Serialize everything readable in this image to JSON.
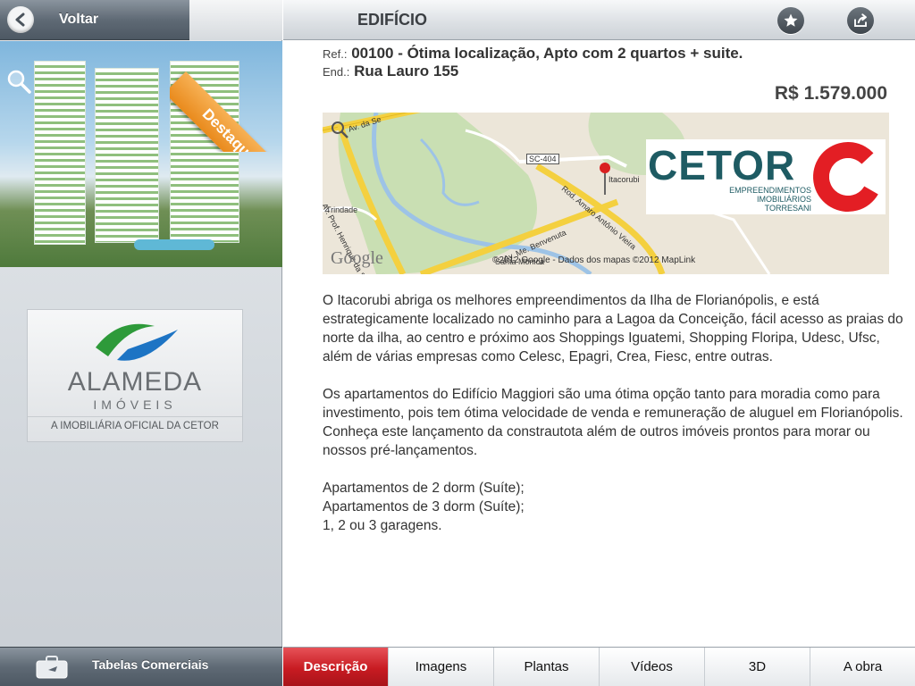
{
  "sidebar": {
    "back_label": "Voltar",
    "badge": "Destaque",
    "logo": {
      "name": "ALAMEDA",
      "sub": "IMÓVEIS",
      "tagline": "A IMOBILIÁRIA OFICIAL DA CETOR"
    },
    "bottom_label": "Tabelas Comerciais"
  },
  "header": {
    "title": "EDIFÍCIO",
    "favorite_icon": "star-icon",
    "share_icon": "share-icon"
  },
  "property": {
    "ref_label": "Ref.:",
    "ref_value": "00100 - Ótima localização, Apto com 2 quartos + suite.",
    "address_label": "End.:",
    "address_value": "Rua Lauro  155",
    "price": "R$ 1.579.000"
  },
  "map": {
    "labels": {
      "road_sc404": "SC-404",
      "itacorubi": "Itacorubi",
      "trindade": "Trindade",
      "av_se": "Av. da Se",
      "av_prof": "Av. Prof. Henrique da Silva Fontes",
      "rod_amaro": "Rod. Amaro Antônio Vieira",
      "av_benvenuta": "Av. Me. Benvenuta",
      "santa_monica": "Santa Mônica"
    },
    "google": "Google",
    "copyright": "©2012 Google - Dados dos mapas ©2012 MapLink",
    "cetor_name": "CETOR",
    "cetor_sub_1": "EMPREENDIMENTOS",
    "cetor_sub_2": "IMOBILIÁRIOS",
    "cetor_sub_3": "TORRESANI"
  },
  "description": {
    "p1": "O Itacorubi abriga os melhores empreendimentos da Ilha de Florianópolis, e está estrategicamente localizado no caminho para a Lagoa da Conceição, fácil acesso as praias do norte da ilha, ao centro e próximo aos Shoppings Iguatemi, Shopping Floripa, Udesc, Ufsc, além de várias empresas como Celesc, Epagri, Crea, Fiesc, entre outras.",
    "p2": "Os apartamentos do Edifício Maggiori são uma ótima opção tanto para moradia como para investimento, pois tem ótima velocidade de venda e remuneração de aluguel em Florianópolis. Conheça este lançamento da constrautota além de outros imóveis prontos para morar ou nossos pré-lançamentos.",
    "line1": "Apartamentos de 2 dorm (Suíte);",
    "line2": "Apartamentos de 3 dorm (Suíte);",
    "line3": "1, 2 ou 3 garagens."
  },
  "tabs": {
    "t1": "Descrição",
    "t2": "Imagens",
    "t3": "Plantas",
    "t4": "Vídeos",
    "t5": "3D",
    "t6": "A obra"
  },
  "colors": {
    "active_tab": "#c81b22",
    "cetor_teal": "#1e5b63",
    "cetor_red": "#e31e24",
    "badge_orange": "#e98a1c"
  }
}
